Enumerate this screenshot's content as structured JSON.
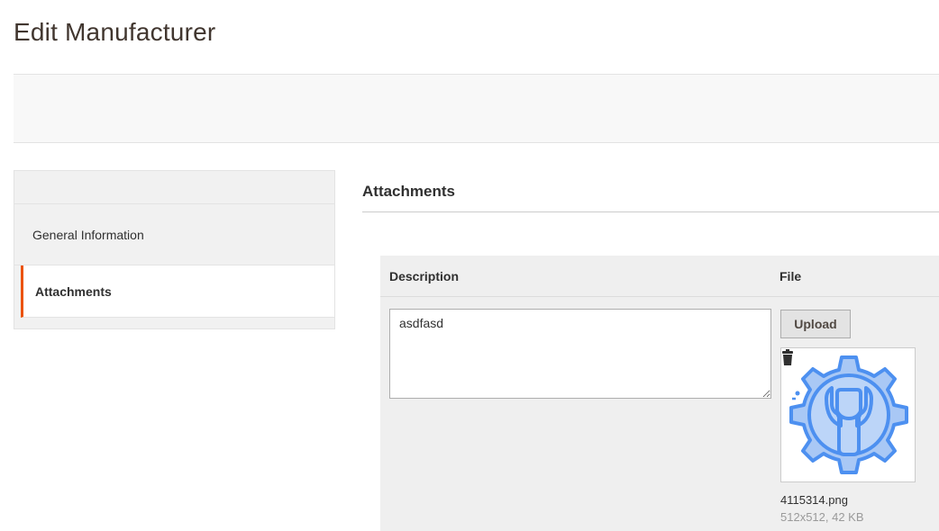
{
  "page": {
    "title": "Edit Manufacturer"
  },
  "sidebar": {
    "items": [
      {
        "label": "General Information",
        "active": false
      },
      {
        "label": "Attachments",
        "active": true
      }
    ]
  },
  "section": {
    "title": "Attachments"
  },
  "grid": {
    "columns": {
      "description": "Description",
      "file": "File"
    },
    "row": {
      "description_value": "asdfasd",
      "upload_label": "Upload",
      "file_name": "4115314.png",
      "file_meta": "512x512, 42 KB",
      "thumbnail_icon": "gear-wrench-icon"
    }
  },
  "colors": {
    "accent": "#eb5202",
    "icon_blue": "#4d90f0",
    "icon_fill": "#a9c8f5"
  }
}
